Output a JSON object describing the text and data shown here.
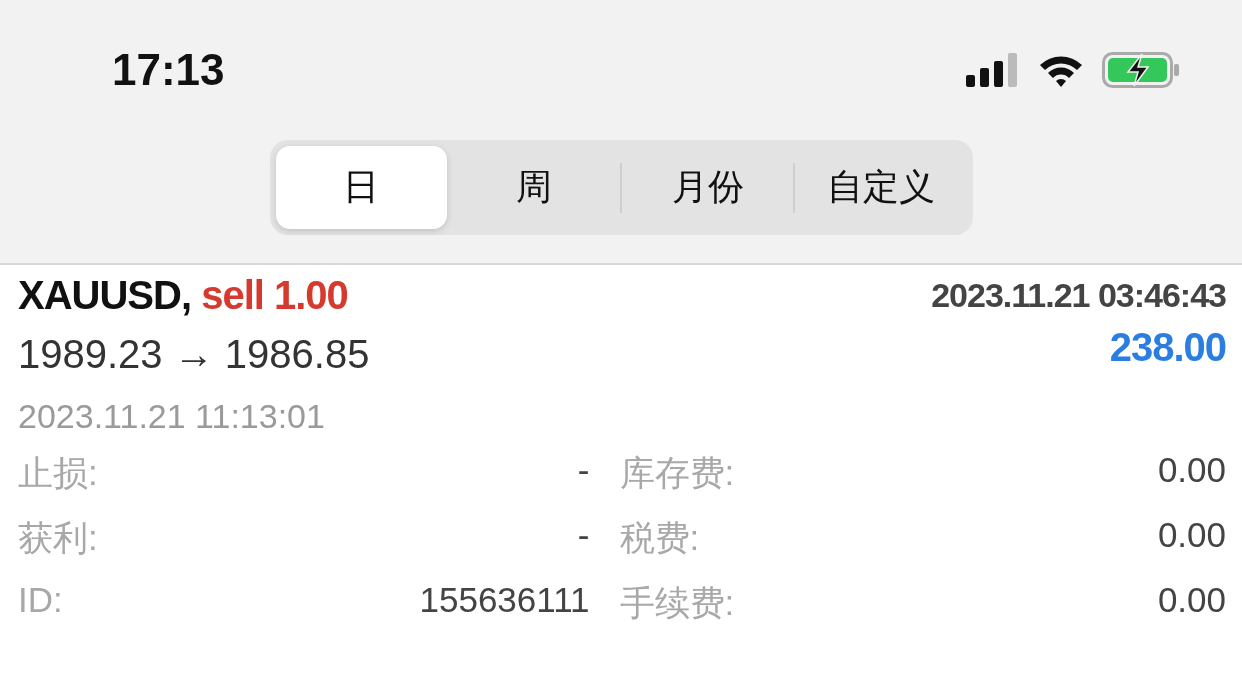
{
  "status_bar": {
    "time": "17:13"
  },
  "period_tabs": [
    {
      "label": "日",
      "selected": true
    },
    {
      "label": "周",
      "selected": false
    },
    {
      "label": "月份",
      "selected": false
    },
    {
      "label": "自定义",
      "selected": false
    }
  ],
  "trade": {
    "symbol": "XAUUSD,",
    "side": "sell 1.00",
    "open_time": "2023.11.21 03:46:43",
    "prices": "1989.23 → 1986.85",
    "profit": "238.00",
    "close_time": "2023.11.21 11:13:01",
    "details": [
      {
        "label": "止损:",
        "value": "-",
        "label_2": "库存费:",
        "value_2": "0.00"
      },
      {
        "label": "获利:",
        "value": "-",
        "label_2": "税费:",
        "value_2": "0.00"
      },
      {
        "label": "ID:",
        "value": "155636111",
        "label_2": "手续费:",
        "value_2": "0.00"
      }
    ]
  }
}
